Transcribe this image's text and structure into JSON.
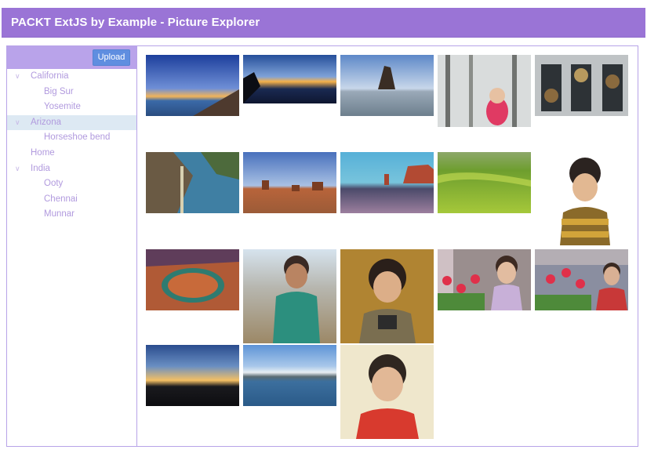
{
  "header": {
    "title": "PACKT ExtJS by Example - Picture Explorer"
  },
  "sidebar": {
    "upload_label": "Upload"
  },
  "tree": [
    {
      "label": "California",
      "level": 0,
      "expandable": true,
      "expanded": true
    },
    {
      "label": "Big Sur",
      "level": 1
    },
    {
      "label": "Yosemite",
      "level": 1
    },
    {
      "label": "Arizona",
      "level": 0,
      "expandable": true,
      "expanded": true,
      "selected": true
    },
    {
      "label": "Horseshoe bend",
      "level": 1
    },
    {
      "label": "Home",
      "level": 0
    },
    {
      "label": "India",
      "level": 0,
      "expandable": true,
      "expanded": true
    },
    {
      "label": "Ooty",
      "level": 1
    },
    {
      "label": "Chennai",
      "level": 1
    },
    {
      "label": "Munnar",
      "level": 1
    }
  ],
  "colors": {
    "header": "#9a74d6",
    "toolbar": "#b9a3ea",
    "button": "#5f8ee0",
    "tree_text": "#b19ade",
    "selected_row": "#dde9f3",
    "border": "#b7a3e8"
  },
  "icons": {
    "expander": "chevron-down-icon"
  }
}
